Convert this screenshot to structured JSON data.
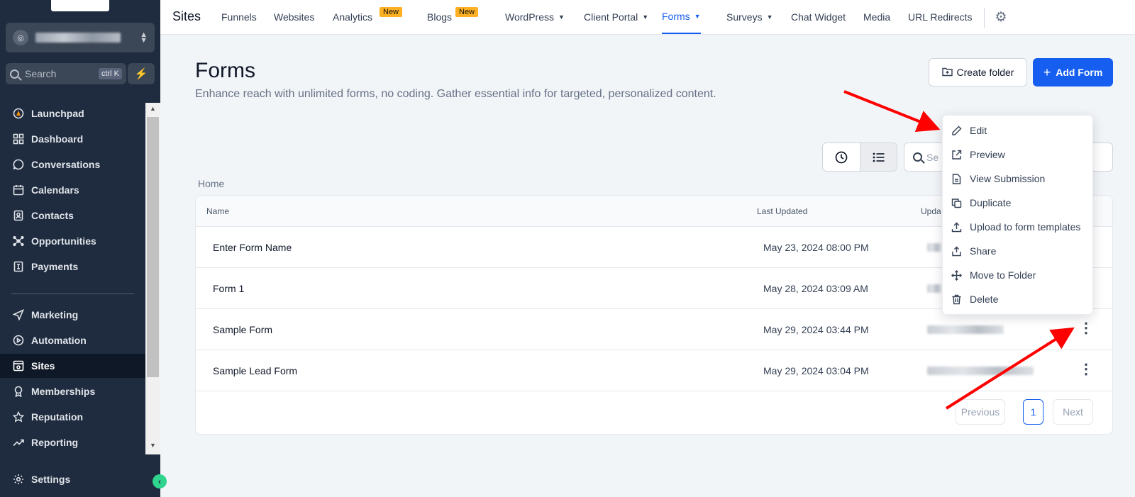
{
  "topnav": {
    "section_title": "Sites",
    "items": [
      {
        "label": "Funnels"
      },
      {
        "label": "Websites"
      },
      {
        "label": "Analytics",
        "badge": "New"
      },
      {
        "label": "Blogs",
        "badge": "New"
      },
      {
        "label": "WordPress"
      },
      {
        "label": "Client Portal"
      },
      {
        "label": "Forms"
      },
      {
        "label": "Surveys"
      },
      {
        "label": "Chat Widget"
      },
      {
        "label": "Media"
      },
      {
        "label": "URL Redirects"
      }
    ],
    "active": "Forms"
  },
  "sidebar": {
    "search_placeholder": "Search",
    "search_shortcut": "ctrl K",
    "items": [
      {
        "label": "Launchpad",
        "icon": "rocket-icon"
      },
      {
        "label": "Dashboard",
        "icon": "grid-icon"
      },
      {
        "label": "Conversations",
        "icon": "chat-icon"
      },
      {
        "label": "Calendars",
        "icon": "calendar-icon"
      },
      {
        "label": "Contacts",
        "icon": "contacts-icon"
      },
      {
        "label": "Opportunities",
        "icon": "network-icon"
      },
      {
        "label": "Payments",
        "icon": "payments-icon"
      },
      {
        "label": "Marketing",
        "icon": "send-icon"
      },
      {
        "label": "Automation",
        "icon": "automation-icon"
      },
      {
        "label": "Sites",
        "icon": "sites-icon"
      },
      {
        "label": "Memberships",
        "icon": "award-icon"
      },
      {
        "label": "Reputation",
        "icon": "star-icon"
      },
      {
        "label": "Reporting",
        "icon": "trend-icon"
      },
      {
        "label": "Settings",
        "icon": "gear-icon"
      }
    ],
    "active": "Sites"
  },
  "page": {
    "title": "Forms",
    "subtitle": "Enhance reach with unlimited forms, no coding. Gather essential info for targeted, personalized content.",
    "create_folder_label": "Create folder",
    "add_form_label": "Add Form",
    "search_placeholder": "Se",
    "breadcrumb": "Home"
  },
  "table": {
    "columns": [
      "Name",
      "Last Updated",
      "Upda"
    ],
    "rows": [
      {
        "name": "Enter Form Name",
        "last_updated": "May 23, 2024 08:00 PM"
      },
      {
        "name": "Form 1",
        "last_updated": "May 28, 2024 03:09 AM"
      },
      {
        "name": "Sample Form",
        "last_updated": "May 29, 2024 03:44 PM"
      },
      {
        "name": "Sample Lead Form",
        "last_updated": "May 29, 2024 03:04 PM"
      }
    ]
  },
  "pagination": {
    "previous": "Previous",
    "page": "1",
    "next": "Next"
  },
  "menu": {
    "items": [
      {
        "label": "Edit",
        "icon": "pencil-icon"
      },
      {
        "label": "Preview",
        "icon": "external-link-icon"
      },
      {
        "label": "View Submission",
        "icon": "document-icon"
      },
      {
        "label": "Duplicate",
        "icon": "copy-icon"
      },
      {
        "label": "Upload to form templates",
        "icon": "upload-icon"
      },
      {
        "label": "Share",
        "icon": "share-icon"
      },
      {
        "label": "Move to Folder",
        "icon": "move-icon"
      },
      {
        "label": "Delete",
        "icon": "trash-icon"
      }
    ]
  },
  "colors": {
    "sidebar_bg": "#1f2b3e",
    "accent": "#155eef",
    "badge": "#fdb022",
    "annotation_arrow": "#ff0000"
  }
}
